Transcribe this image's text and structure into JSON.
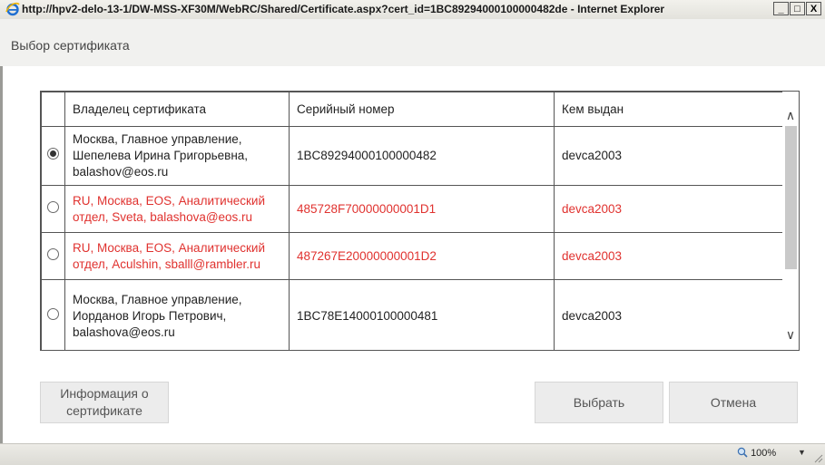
{
  "window": {
    "title": "http://hpv2-delo-13-1/DW-MSS-XF30M/WebRC/Shared/Certificate.aspx?cert_id=1BC89294000100000482de - Internet Explorer",
    "minimize": "_",
    "maximize": "□",
    "close": "X"
  },
  "dialog": {
    "title": "Выбор сертификата"
  },
  "table": {
    "headers": {
      "owner": "Владелец сертификата",
      "serial": "Серийный номер",
      "issuer": "Кем выдан"
    },
    "rows": [
      {
        "owner": "Москва, Главное управление, Шепелева Ирина Григорьевна, balashov@eos.ru",
        "serial": "1BC89294000100000482",
        "issuer": "devca2003",
        "selected": true,
        "highlighted": false
      },
      {
        "owner": "RU, Москва, EOS, Аналитический отдел, Sveta, balashova@eos.ru",
        "serial": "485728F70000000001D1",
        "issuer": "devca2003",
        "selected": false,
        "highlighted": true
      },
      {
        "owner": "RU, Москва, EOS, Аналитический отдел, Aculshin, sballl@rambler.ru",
        "serial": "487267E20000000001D2",
        "issuer": "devca2003",
        "selected": false,
        "highlighted": true
      },
      {
        "owner": "Москва, Главное управление, Иорданов Игорь Петрович, balashova@eos.ru",
        "serial": "1BC78E14000100000481",
        "issuer": "devca2003",
        "selected": false,
        "highlighted": false
      }
    ]
  },
  "buttons": {
    "info": "Информация о сертификате",
    "select": "Выбрать",
    "cancel": "Отмена"
  },
  "statusbar": {
    "zoom": "100%"
  },
  "colors": {
    "highlight_text": "#e0322f",
    "status_bar": "#dcdbd5"
  },
  "icons": {
    "browser": "ie-logo-icon",
    "zoom": "magnifier-icon"
  }
}
